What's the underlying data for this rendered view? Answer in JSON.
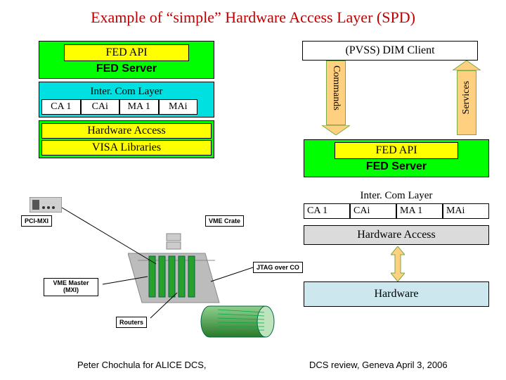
{
  "title": "Example of “simple” Hardware Access Layer (SPD)",
  "left": {
    "fed_api": "FED API",
    "fed_server": "FED Server",
    "intercom": "Inter. Com Layer",
    "ca1": "CA 1",
    "cai": "CAi",
    "ma1": "MA 1",
    "mai": "MAi",
    "hw_access": "Hardware Access",
    "visa": "VISA Libraries"
  },
  "right": {
    "dim_client": "(PVSS) DIM Client",
    "commands": "Commands",
    "services": "Services",
    "fed_api": "FED API",
    "fed_server": "FED Server",
    "intercom": "Inter. Com Layer",
    "ca1": "CA 1",
    "cai": "CAi",
    "ma1": "MA 1",
    "mai": "MAi",
    "hw_access": "Hardware Access",
    "hardware": "Hardware"
  },
  "labels": {
    "pci_mxi": "PCI-MXI",
    "vme_crate": "VME Crate",
    "jtag": "JTAG over CO",
    "vme_master": "VME Master (MXI)",
    "routers": "Routers"
  },
  "footer": {
    "left": "Peter Chochula for ALICE DCS,",
    "right": "DCS review, Geneva April 3, 2006"
  }
}
